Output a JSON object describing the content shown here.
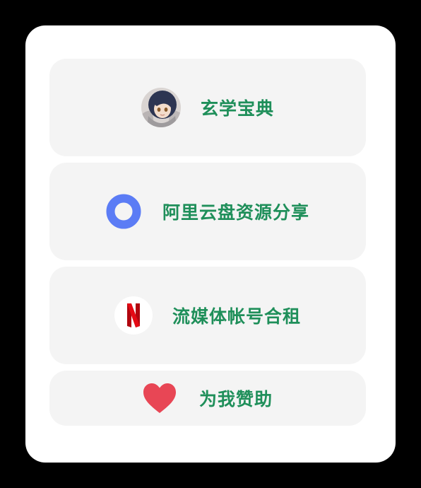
{
  "links": [
    {
      "label": "玄学宝典",
      "icon": "avatar-icon"
    },
    {
      "label": "阿里云盘资源分享",
      "icon": "ring-icon"
    },
    {
      "label": "流媒体帐号合租",
      "icon": "netflix-icon"
    },
    {
      "label": "为我赞助",
      "icon": "heart-icon"
    }
  ],
  "colors": {
    "label": "#1f8f5a",
    "ring": "#5b7cf5",
    "netflix": "#e50914",
    "heart": "#e84655",
    "tile": "#f4f4f4"
  }
}
